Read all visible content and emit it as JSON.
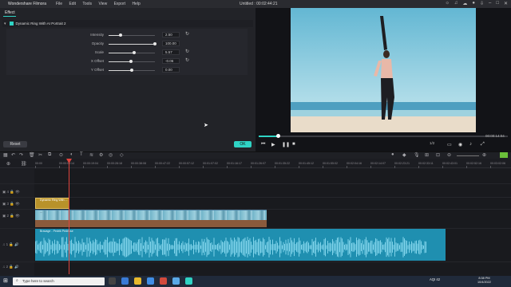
{
  "window": {
    "app_name": "Wondershare Filmora",
    "title": "Untitled : 00:02:44:21"
  },
  "menu": [
    "File",
    "Edit",
    "Tools",
    "View",
    "Export",
    "Help"
  ],
  "effect_panel": {
    "tab_label": "Effect",
    "effect_name": "Dynamic Ring With AI Portrait 2",
    "params": [
      {
        "label": "Intensity",
        "value": "2.50",
        "level": 0.25
      },
      {
        "label": "Opacity",
        "value": "100.00",
        "level": 1.0
      },
      {
        "label": "Scale",
        "value": "5.57",
        "level": 0.56
      },
      {
        "label": "X Offset",
        "value": "-0.06",
        "level": 0.49
      },
      {
        "label": "Y Offset",
        "value": "0.00",
        "level": 0.5
      }
    ],
    "reset_label": "Reset",
    "ok_label": "OK"
  },
  "preview": {
    "timecode": "00:00:14:04",
    "zoom": "1/2",
    "progress": 0.077
  },
  "timeline": {
    "ruler_ticks": [
      "00:00",
      "00:00:09:14",
      "00:00:19:04",
      "00:00:28:18",
      "00:00:38:08",
      "00:00:47:22",
      "00:00:57:12",
      "00:01:07:02",
      "00:01:16:17",
      "00:01:26:07",
      "00:01:35:22",
      "00:01:45:12",
      "00:01:55:02",
      "00:02:04:16",
      "00:02:14:07",
      "00:02:23:21",
      "00:02:33:11",
      "00:02:43:01",
      "00:02:52:16",
      "00:03:02:06"
    ],
    "effect_clip_label": "Dynamic Ring With ...",
    "video_clip_label": "...",
    "audio_clip_label": "Bravage - Pedrik Pedrikse"
  },
  "taskbar": {
    "search_placeholder": "Type here to search",
    "aqi": "AQI 42",
    "time": "8:38 PM",
    "date": "10/4/2022"
  },
  "colors": {
    "accent": "#2fd3c4",
    "playhead": "#e0443e",
    "audio_clip": "#1f8fb0",
    "effect_clip": "#b8922a"
  }
}
